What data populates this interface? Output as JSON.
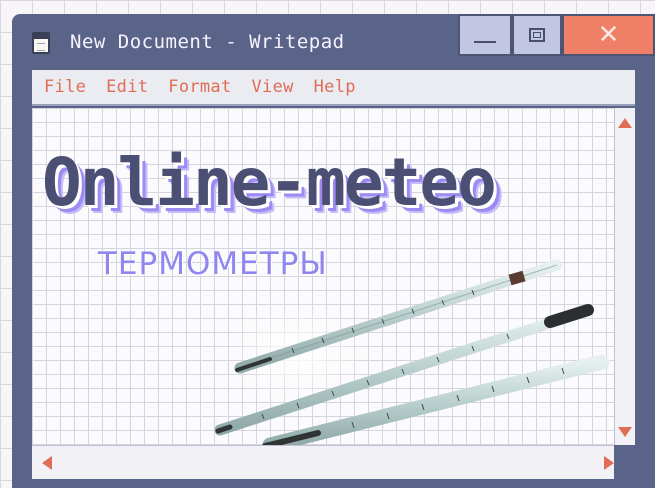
{
  "window": {
    "title": "New Document - Writepad",
    "icon": "document-icon"
  },
  "controls": {
    "minimize_icon": "minimize-icon",
    "maximize_icon": "maximize-icon",
    "close_glyph": "✕"
  },
  "menu": {
    "items": [
      "File",
      "Edit",
      "Format",
      "View",
      "Help"
    ]
  },
  "document": {
    "heading": "Online-meteo",
    "subheading": "ТЕРМОМЕТРЫ",
    "image": "laboratory-thermometers"
  },
  "colors": {
    "window_frame": "#5a6488",
    "menu_accent": "#e06d55",
    "close_button": "#f07f67",
    "heading_shadow": "#9c8cf2",
    "subheading": "#8f86f0"
  }
}
